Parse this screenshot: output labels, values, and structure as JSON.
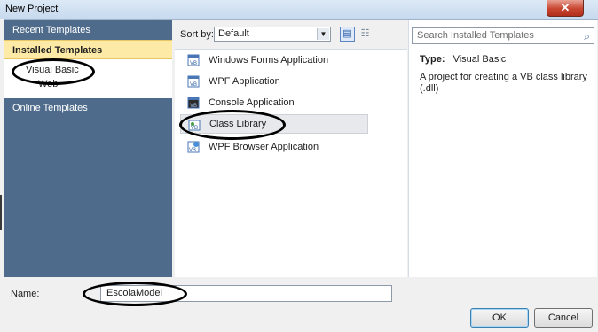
{
  "window": {
    "title": "New Project",
    "close_glyph": "✕"
  },
  "sidebar": {
    "recent": "Recent Templates",
    "installed": "Installed Templates",
    "items": [
      {
        "label": "Visual Basic"
      },
      {
        "label": "Web"
      }
    ],
    "online": "Online Templates"
  },
  "toolbar": {
    "sort_label": "Sort by:",
    "sort_value": "Default",
    "sort_arrow": "▼",
    "view_list_glyph": "▤",
    "view_detail_glyph": "☷"
  },
  "templates": [
    {
      "label": "Windows Forms Application",
      "selected": false
    },
    {
      "label": "WPF Application",
      "selected": false
    },
    {
      "label": "Console Application",
      "selected": false
    },
    {
      "label": "Class Library",
      "selected": true
    },
    {
      "label": "WPF Browser Application",
      "selected": false
    }
  ],
  "details": {
    "search_placeholder": "Search Installed Templates",
    "search_icon": "⌕",
    "type_label": "Type:",
    "type_value": "Visual Basic",
    "description": "A project for creating a VB class library (.dll)"
  },
  "form": {
    "name_label": "Name:",
    "name_value": "EscolaModel"
  },
  "buttons": {
    "ok": "OK",
    "cancel": "Cancel"
  },
  "colors": {
    "sidebar_bg": "#4e6b8b",
    "selected_category_bg": "#fdeaa7",
    "title_bar": "#c7d9ee",
    "close_button": "#c8452f"
  }
}
